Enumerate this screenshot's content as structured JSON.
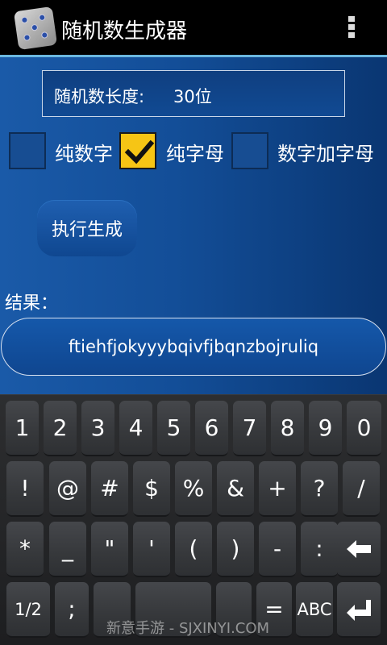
{
  "app": {
    "title": "随机数生成器",
    "icon": "dice-icon",
    "overflow_icon": "overflow-menu-icon"
  },
  "form": {
    "length_label": "随机数长度:",
    "length_value": "30位",
    "options": [
      {
        "label": "纯数字",
        "checked": false
      },
      {
        "label": "纯字母",
        "checked": true
      },
      {
        "label": "数字加字母",
        "checked": false
      }
    ],
    "generate_label": "执行生成",
    "result_label": "结果：",
    "result_value": "ftiehfjokyyybqivfjbqnzbojruliq"
  },
  "keyboard": {
    "row1": [
      "1",
      "2",
      "3",
      "4",
      "5",
      "6",
      "7",
      "8",
      "9",
      "0"
    ],
    "row2": [
      "!",
      "@",
      "#",
      "$",
      "%",
      "&",
      "+",
      "?",
      "/"
    ],
    "row3": [
      "*",
      "_",
      "\"",
      "'",
      "(",
      ")",
      "-",
      ":"
    ],
    "row4_left": "1/2",
    "row4_semicolon": ";",
    "row4_equals": "=",
    "row4_abc": "ABC",
    "backspace_icon": "backspace-icon",
    "enter_icon": "enter-icon"
  },
  "watermark": "新意手游 - SJXINYI.COM",
  "colors": {
    "background": "#134e98",
    "accent_line": "#6bb8e0",
    "checkbox_checked": "#f6c515"
  }
}
